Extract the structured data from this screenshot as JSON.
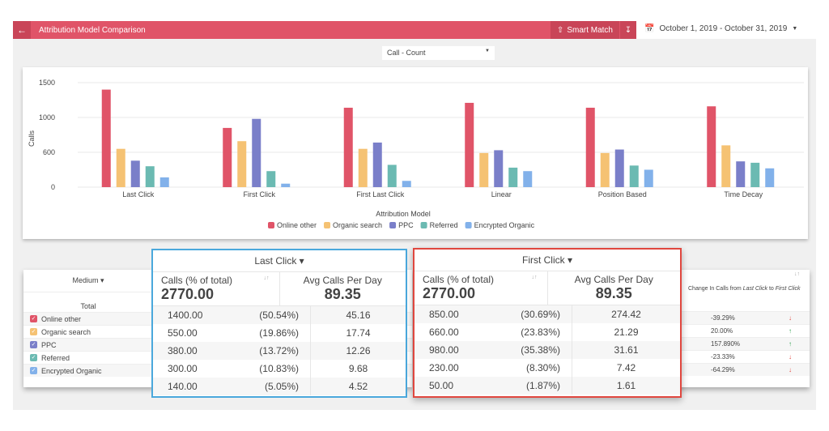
{
  "header": {
    "title": "Attribution Model Comparison",
    "smart_match": "Smart Match",
    "date_range": "October 1, 2019 - October 31, 2019"
  },
  "metric_select": {
    "value": "Call - Count"
  },
  "colors": {
    "accent": "#e05468",
    "Online other": "#e05468",
    "Organic search": "#f5c273",
    "PPC": "#7a7fc9",
    "Referred": "#6bbab2",
    "Encrypted Organic": "#82b1ea",
    "last_click_border": "#4aa8dc",
    "first_click_border": "#e0473f"
  },
  "chart_data": {
    "type": "bar",
    "xlabel": "Attribution Model",
    "ylabel": "Calls",
    "ylim": [
      0,
      1500
    ],
    "y_ticks": [
      {
        "value": 0,
        "label": "0"
      },
      {
        "value": 500,
        "label": "600"
      },
      {
        "value": 1000,
        "label": "1000"
      },
      {
        "value": 1500,
        "label": "1500"
      }
    ],
    "grid": true,
    "legend_placement": "bottom",
    "categories": [
      "Last Click",
      "First Click",
      "First Last Click",
      "Linear",
      "Position Based",
      "Time Decay"
    ],
    "series": [
      {
        "name": "Online other",
        "values": [
          1400,
          850,
          1140,
          1210,
          1140,
          1160
        ]
      },
      {
        "name": "Organic search",
        "values": [
          550,
          660,
          550,
          490,
          490,
          600
        ]
      },
      {
        "name": "PPC",
        "values": [
          380,
          980,
          640,
          530,
          540,
          370
        ]
      },
      {
        "name": "Referred",
        "values": [
          300,
          230,
          320,
          280,
          310,
          350
        ]
      },
      {
        "name": "Encrypted Organic",
        "values": [
          140,
          50,
          90,
          230,
          250,
          270
        ]
      }
    ]
  },
  "medium_table": {
    "header": "Medium",
    "total_label": "Total",
    "rows": [
      "Online other",
      "Organic search",
      "PPC",
      "Referred",
      "Encrypted Organic"
    ]
  },
  "last_click": {
    "title": "Last Click",
    "col1": "Calls (% of total)",
    "col2": "Avg Calls Per Day",
    "total": "2770.00",
    "avg_total": "89.35",
    "rows": [
      [
        "1400.00",
        "(50.54%)",
        "45.16"
      ],
      [
        "550.00",
        "(19.86%)",
        "17.74"
      ],
      [
        "380.00",
        "(13.72%)",
        "12.26"
      ],
      [
        "300.00",
        "(10.83%)",
        "9.68"
      ],
      [
        "140.00",
        "(5.05%)",
        "4.52"
      ]
    ]
  },
  "first_click": {
    "title": "First Click",
    "col1": "Calls (% of total)",
    "col2": "Avg Calls Per Day",
    "total": "2770.00",
    "avg_total": "89.35",
    "rows": [
      [
        "850.00",
        "(30.69%)",
        "274.42"
      ],
      [
        "660.00",
        "(23.83%)",
        "21.29"
      ],
      [
        "980.00",
        "(35.38%)",
        "31.61"
      ],
      [
        "230.00",
        "(8.30%)",
        "7.42"
      ],
      [
        "50.00",
        "(1.87%)",
        "1.61"
      ]
    ]
  },
  "change_table": {
    "header_prefix": "Change In Calls from ",
    "from": "Last Click",
    "mid": " to ",
    "to": "First Click",
    "rows": [
      {
        "value": "-39.29%",
        "dir": "down"
      },
      {
        "value": "20.00%",
        "dir": "up"
      },
      {
        "value": "157.890%",
        "dir": "up"
      },
      {
        "value": "-23.33%",
        "dir": "down"
      },
      {
        "value": "-64.29%",
        "dir": "down"
      }
    ]
  }
}
